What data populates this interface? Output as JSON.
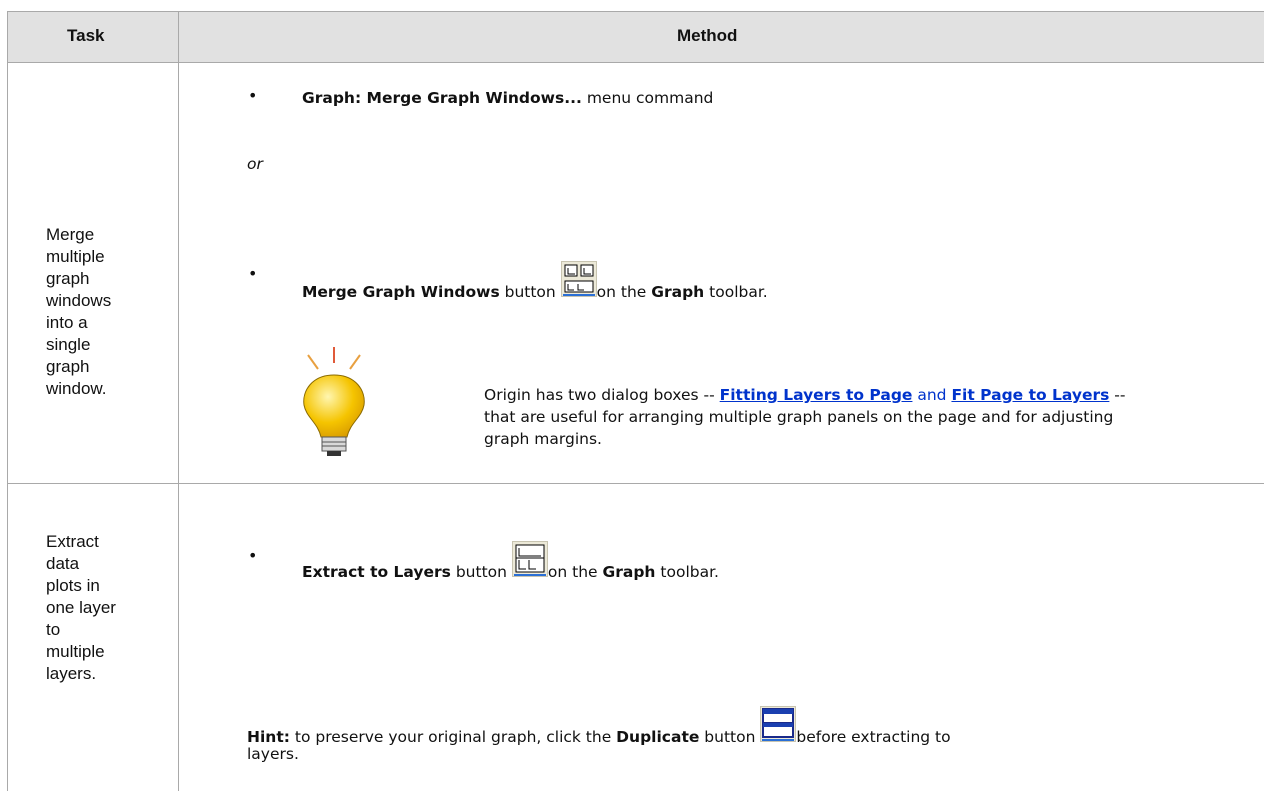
{
  "header": {
    "task": "Task",
    "method": "Method"
  },
  "row1": {
    "task": "Merge multiple graph windows into a single graph window.",
    "bullet1_bold": "Graph: Merge Graph Windows...",
    "bullet1_rest": " menu command",
    "or": "or",
    "bullet2_bold": "Merge Graph Windows",
    "bullet2_mid": " button ",
    "bullet2_after": "on the ",
    "bullet2_bold2": "Graph",
    "bullet2_end": " toolbar.",
    "note_pre": "Origin has two dialog boxes -- ",
    "note_link1": "Fitting Layers to Page",
    "note_and": " and ",
    "note_link2": "Fit Page to Layers",
    "note_post": " -- that are useful for arranging multiple graph panels on the page and for adjusting graph margins."
  },
  "row2": {
    "task": "Extract data plots in one layer to multiple layers.",
    "bullet_bold": "Extract to Layers",
    "bullet_mid": " button ",
    "bullet_after": "on the ",
    "bullet_bold2": "Graph",
    "bullet_end": " toolbar.",
    "hint_label": "Hint:",
    "hint_pre": " to preserve your original graph, click the ",
    "hint_bold": "Duplicate",
    "hint_mid": " button ",
    "hint_post": "before extracting to",
    "hint_line2": "layers."
  },
  "icons": {
    "merge": "merge-graph-windows-icon",
    "extract": "extract-to-layers-icon",
    "duplicate": "duplicate-icon",
    "tip": "lightbulb-icon"
  },
  "colors": {
    "header_bg": "#e1e1e1",
    "link": "#0033cc",
    "border": "#a9a9a9",
    "bulb": "#f5c400"
  }
}
